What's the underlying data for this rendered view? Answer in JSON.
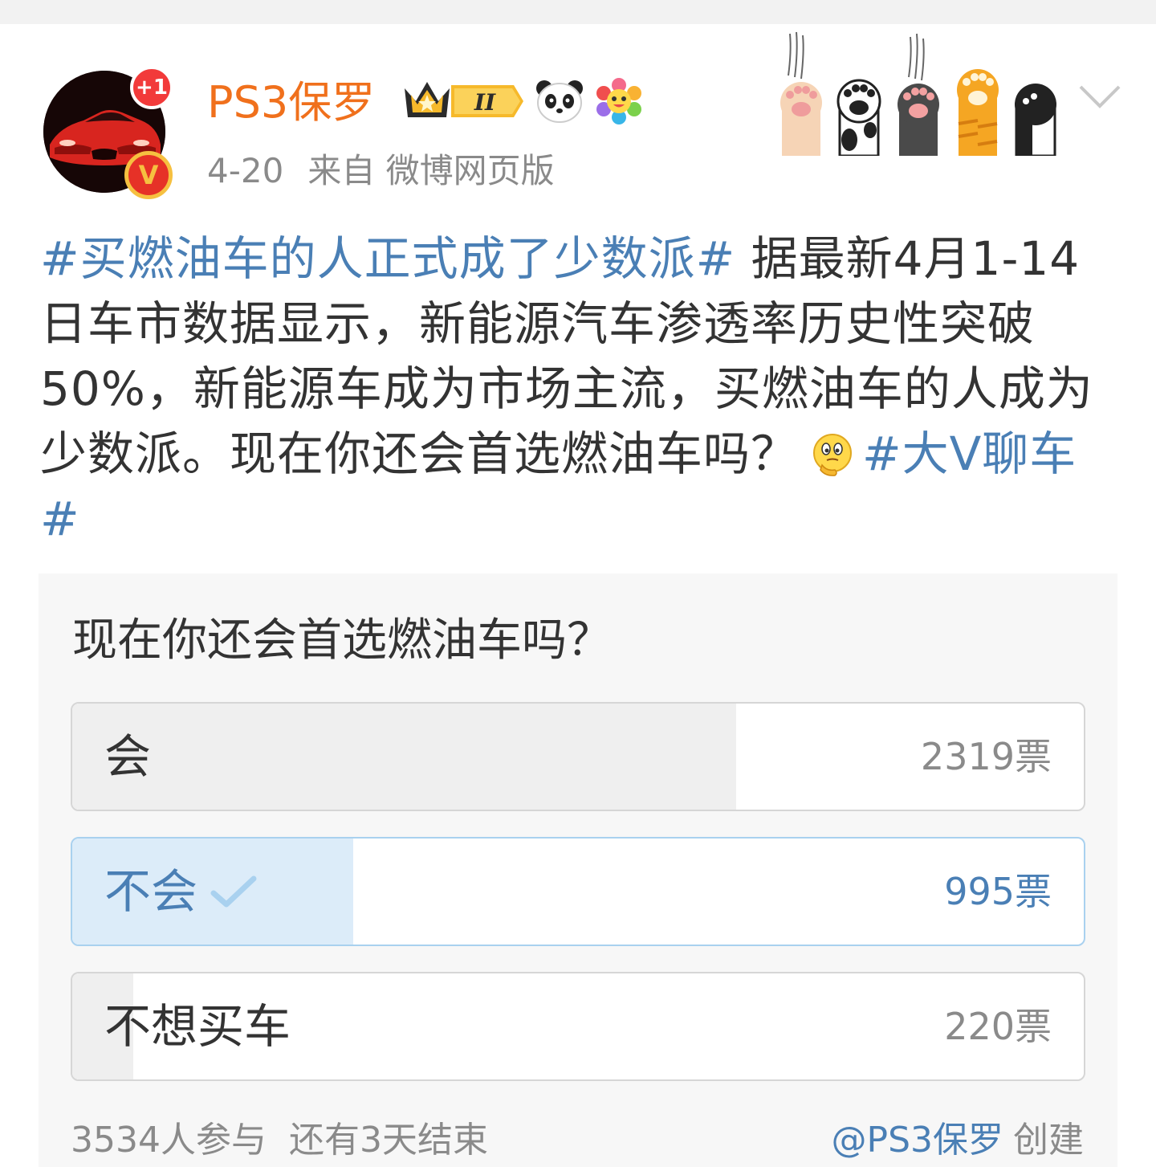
{
  "header": {
    "username": "PS3保罗",
    "notification_badge": "+1",
    "verified_mark": "V",
    "level_badge": "II",
    "date": "4-20",
    "source": "来自 微博网页版"
  },
  "post": {
    "hashtag_1": "#买燃油车的人正式成了少数派#",
    "body": " 据最新4月1-14日车市数据显示，新能源汽车渗透率历史性突破50%，新能源车成为市场主流，买燃油车的人成为少数派。现在你还会首选燃油车吗？",
    "hashtag_2": "#大V聊车#"
  },
  "poll": {
    "question": "现在你还会首选燃油车吗？",
    "options": [
      {
        "label": "会",
        "votes": "2319票",
        "vote_count": 2319,
        "fill_fraction": 0.656,
        "selected": false
      },
      {
        "label": "不会",
        "votes": "995票",
        "vote_count": 995,
        "fill_fraction": 0.278,
        "selected": true
      },
      {
        "label": "不想买车",
        "votes": "220票",
        "vote_count": 220,
        "fill_fraction": 0.06,
        "selected": false
      }
    ],
    "participants": "3534人参与",
    "time_left": "还有3天结束",
    "creator_link": "@PS3保罗",
    "creator_suffix": "创建"
  },
  "colors": {
    "username": "#f0701c",
    "link_blue": "#4a7fb5",
    "selected_fill": "#dcecf9",
    "bar_fill": "#efefef"
  },
  "icons": [
    "car-avatar",
    "notification-badge",
    "verified-v-icon",
    "crown-level-badge",
    "panda-icon",
    "flower-icon",
    "cat-paws-decoration",
    "chevron-down-icon",
    "thinking-face-icon",
    "check-icon"
  ]
}
